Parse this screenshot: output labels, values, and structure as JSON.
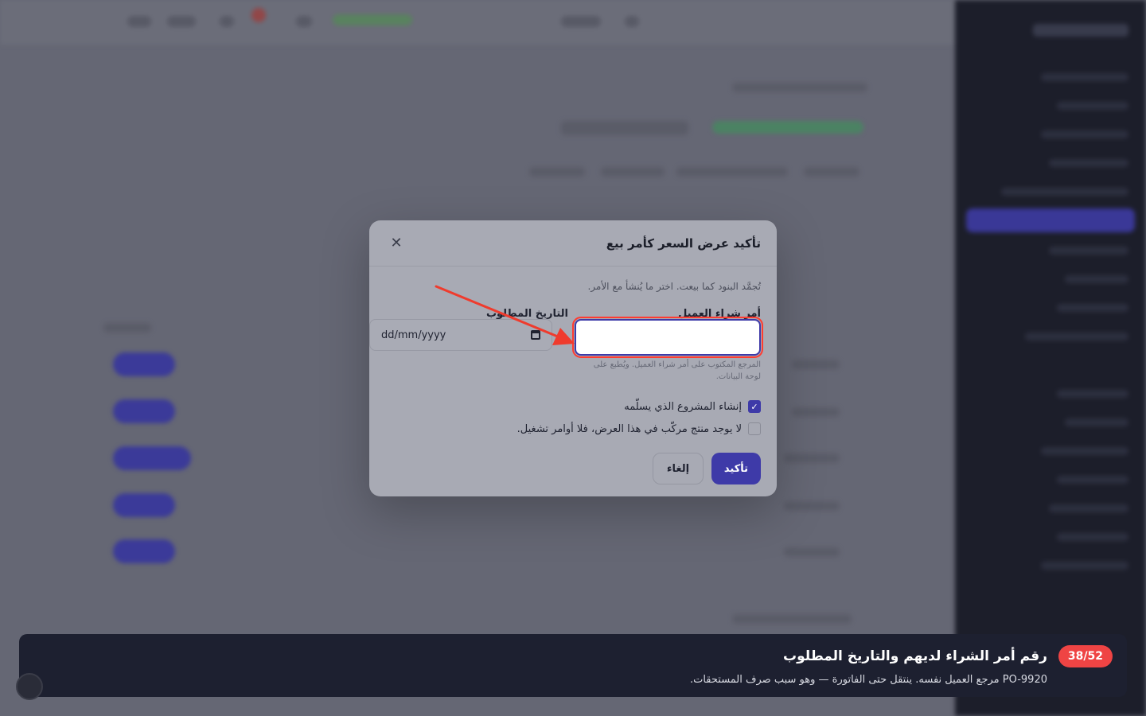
{
  "modal": {
    "title": "تأكيد عرض السعر كأمر بيع",
    "close_glyph": "✕",
    "helper": "تُجمَّد البنود كما بيعت. اختر ما يُنشأ مع الأمر.",
    "po_label": "أمر شراء العميل",
    "po_value": "",
    "po_hint": "المرجع المكتوب على أمر شراء العميل. ويُطبع على لوحة البيانات.",
    "date_label": "التاريخ المطلوب",
    "date_placeholder": "dd/mm/yyyy",
    "create_project_label": "إنشاء المشروع الذي يسلّمه",
    "create_project_checked": true,
    "no_build_label": "لا يوجد منتج مركّب في هذا العرض، فلا أوامر تشغيل.",
    "no_build_checked": false,
    "confirm_label": "تأكيد",
    "cancel_label": "إلغاء"
  },
  "tour": {
    "step": "38/52",
    "title": "رقم أمر الشراء لديهم والتاريخ المطلوب",
    "description": "PO-9920 مرجع العميل نفسه. ينتقل حتى الفاتورة — وهو سبب صرف المستحقات."
  },
  "colors": {
    "accent": "#3e3aa8",
    "highlight": "#ff3b30",
    "banner_bg": "#1d2030",
    "badge": "#ef4444"
  }
}
